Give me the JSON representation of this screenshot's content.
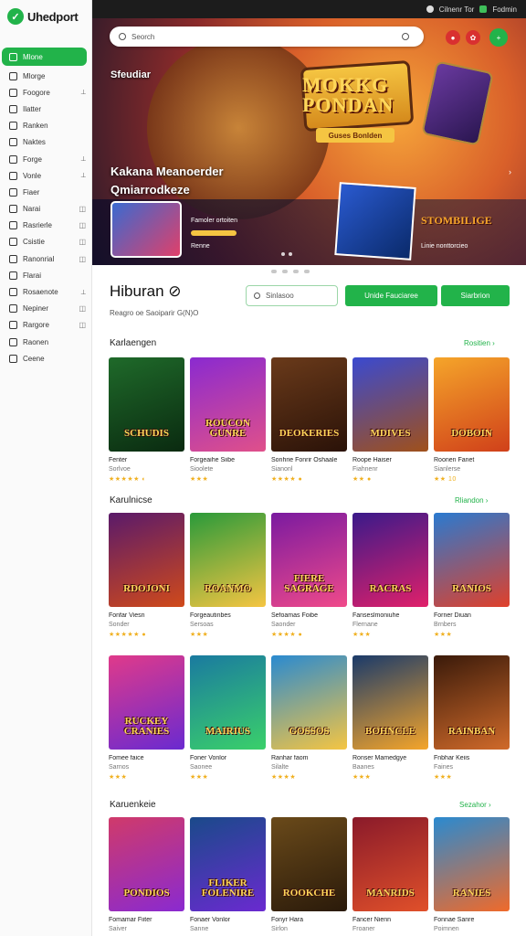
{
  "brand": {
    "name": "Uhedport"
  },
  "topbar": {
    "link1": "Cilnenr Tor",
    "link2": "Fodmin"
  },
  "sidebar": {
    "items": [
      {
        "label": "Mlone",
        "suffix": ""
      },
      {
        "label": "Mlorge",
        "suffix": ""
      },
      {
        "label": "Foogore",
        "suffix": "⟂"
      },
      {
        "label": "Ilatter",
        "suffix": ""
      },
      {
        "label": "Ranken",
        "suffix": ""
      },
      {
        "label": "Naktes",
        "suffix": ""
      },
      {
        "label": "Forge",
        "suffix": "⟂"
      },
      {
        "label": "Vonle",
        "suffix": "⟂"
      },
      {
        "label": "Fiaer",
        "suffix": ""
      },
      {
        "label": "Narai",
        "suffix": "◫"
      },
      {
        "label": "Rasrierle",
        "suffix": "◫"
      },
      {
        "label": "Csistie",
        "suffix": "◫"
      },
      {
        "label": "Ranonrial",
        "suffix": "◫"
      },
      {
        "label": "Flarai",
        "suffix": ""
      },
      {
        "label": "Rosaenote",
        "suffix": "⟂"
      },
      {
        "label": "Nepiner",
        "suffix": "◫"
      },
      {
        "label": "Rargore",
        "suffix": "◫"
      },
      {
        "label": "Raonen",
        "suffix": ""
      },
      {
        "label": "Ceene",
        "suffix": ""
      }
    ]
  },
  "search": {
    "placeholder": "Seorch"
  },
  "hero": {
    "label": "Sfeudiar",
    "title_line1": "MOKKG",
    "title_line2": "PONDAN",
    "cta": "Guses Bonlden",
    "heading_line1": "Kakana Meanoerder",
    "heading_line2": "Qmiarrodkeze",
    "strip_text1": "Famoler ortoiten",
    "strip_text2": "Renne",
    "strip_title3": "STOMBILIGE",
    "strip_text3": "Linie nonttorcieo"
  },
  "page": {
    "title": "Hiburan ⊘",
    "subtitle": "Reagro oe Saoiparir G(N)O",
    "filter_placeholder": "Sinlasoo",
    "btn_primary": "Unide Fauciaree",
    "btn_secondary": "Siarbrion"
  },
  "sections": [
    {
      "title": "Karlaengen",
      "link": "Rositien ›"
    },
    {
      "title": "Karulnicse",
      "link": "Rliandon ›"
    },
    {
      "title": "Karuenkeie",
      "link": "Sezahor ›"
    }
  ],
  "rows": [
    [
      {
        "art": "SCHUDIS",
        "name": "Fenter",
        "sub": "Sorlvoe",
        "stars": "★★★★★ ◐",
        "bg": "linear-gradient(160deg,#1f6a2a,#0a2a10)"
      },
      {
        "art": "ROUCON GUNRE",
        "name": "Forgeaihe Siibe",
        "sub": "Sioolete",
        "stars": "★★★",
        "bg": "linear-gradient(160deg,#8a2ad0,#e0508a)"
      },
      {
        "art": "DEOKERIES",
        "name": "Sonhrie Fonrir Oshaale",
        "sub": "Sianonl",
        "stars": "★★★★ ●",
        "bg": "linear-gradient(160deg,#6a3a1a,#2a1208)"
      },
      {
        "art": "MDIVES",
        "name": "Roope Haiser",
        "sub": "Fiahnenr",
        "stars": "★★ ●",
        "bg": "linear-gradient(160deg,#3a4ad0,#a0501a)"
      },
      {
        "art": "DOBOIN",
        "name": "Roonen Fanet",
        "sub": "Sianlerse",
        "stars": "★★ 10",
        "bg": "linear-gradient(160deg,#f5a52a,#d0401a)"
      }
    ],
    [
      {
        "art": "RDOJONI",
        "name": "Fonfar Viesn",
        "sub": "Sonder",
        "stars": "★★★★★ ●",
        "bg": "linear-gradient(160deg,#5a1a6a,#d04a1a)"
      },
      {
        "art": "ROANMO",
        "name": "Forgeautinbes",
        "sub": "Sersoas",
        "stars": "★★★",
        "bg": "linear-gradient(160deg,#2a9a3a,#f5c542)"
      },
      {
        "art": "FIERE SAGRAGE",
        "name": "Sefoamas Foibe",
        "sub": "Saonder",
        "stars": "★★★★ ●",
        "bg": "linear-gradient(160deg,#7a1aa0,#f04a8a)"
      },
      {
        "art": "RACRAS",
        "name": "Fanseslmoniuhe",
        "sub": "Flernane",
        "stars": "★★★",
        "bg": "linear-gradient(160deg,#3a1a8a,#e0206a)"
      },
      {
        "art": "RANIOS",
        "name": "Forner Diuan",
        "sub": "Brnbers",
        "stars": "★★★",
        "bg": "linear-gradient(160deg,#2a7ad0,#e0402a)"
      }
    ],
    [
      {
        "art": "RUCKEY CRANIES",
        "name": "Fomee faice",
        "sub": "Sarnos",
        "stars": "★★★",
        "bg": "linear-gradient(160deg,#e03a8a,#6a2ad0)"
      },
      {
        "art": "MAIRIUS",
        "name": "Foner Vonlor",
        "sub": "Saonee",
        "stars": "★★★",
        "bg": "linear-gradient(160deg,#1a7aa0,#3ad06a)"
      },
      {
        "art": "GOSSOS",
        "name": "Ranhar faom",
        "sub": "Silalte",
        "stars": "★★★★",
        "bg": "linear-gradient(160deg,#2a8ad0,#f5c542)"
      },
      {
        "art": "BOHNCLE",
        "name": "Ronser Mamedgye",
        "sub": "Baanes",
        "stars": "★★★",
        "bg": "linear-gradient(160deg,#1a3a6a,#f5a52a)"
      },
      {
        "art": "RAINBAN",
        "name": "Fnbhar Keiis",
        "sub": "Faines",
        "stars": "★★★",
        "bg": "linear-gradient(160deg,#3a1a0a,#d06a2a)"
      }
    ],
    [
      {
        "art": "PONDIOS",
        "name": "Fomamar Fiiter",
        "sub": "Saiver",
        "stars": "",
        "bg": "linear-gradient(160deg,#d03a6a,#8a2ad0)"
      },
      {
        "art": "FLIKER FOLENIRE",
        "name": "Fonaer Vonlor",
        "sub": "Sanne",
        "stars": "",
        "bg": "linear-gradient(160deg,#1a4a8a,#6a2ad0)"
      },
      {
        "art": "ROOKCHE",
        "name": "Fonyr Hara",
        "sub": "Sirlon",
        "stars": "",
        "bg": "linear-gradient(160deg,#6a4a1a,#2a1a0a)"
      },
      {
        "art": "MANRIDS",
        "name": "Fancer Nienn",
        "sub": "Froaner",
        "stars": "",
        "bg": "linear-gradient(160deg,#8a1a2a,#e0502a)"
      },
      {
        "art": "RANIES",
        "name": "Fonnae Sanre",
        "sub": "Poimnen",
        "stars": "",
        "bg": "linear-gradient(160deg,#2a8ad0,#f06a2a)"
      }
    ]
  ],
  "colors": {
    "accent": "#22b34a",
    "topbar": "#1c1c1c",
    "star": "#f0b020"
  }
}
